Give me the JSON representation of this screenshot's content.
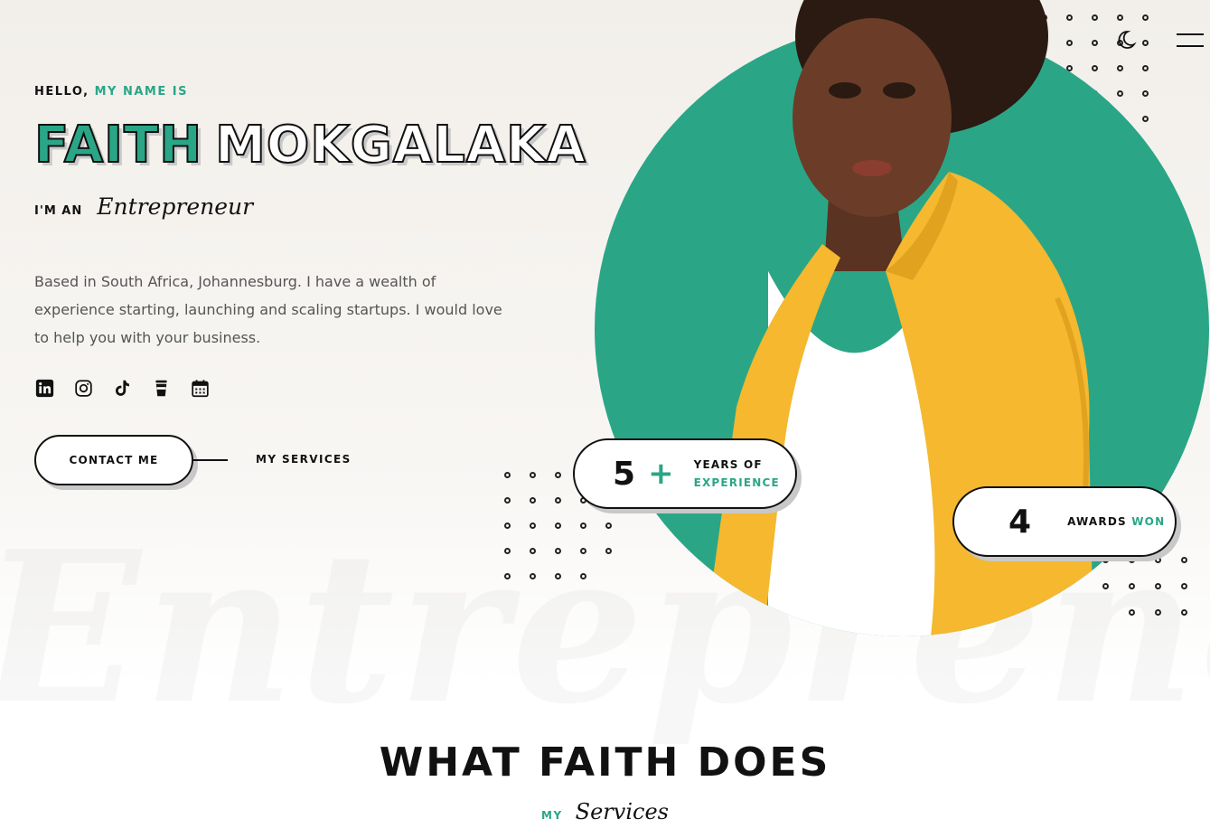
{
  "hero": {
    "greeting_plain": "HELLO,",
    "greeting_accent": "MY NAME IS",
    "first_name": "FAITH",
    "last_name": "MOKGALAKA",
    "role_prefix": "I'M AN",
    "role": "Entrepreneur",
    "background_word": "Entrepreneur",
    "bio": "Based in South Africa, Johannesburg. I have a wealth of experience starting, launching and scaling startups. I would love to help you with your business."
  },
  "socials": [
    {
      "name": "linkedin-icon"
    },
    {
      "name": "instagram-icon"
    },
    {
      "name": "tiktok-icon"
    },
    {
      "name": "coffee-cup-icon"
    },
    {
      "name": "calendar-icon"
    }
  ],
  "actions": {
    "contact_label": "CONTACT ME",
    "services_label": "MY SERVICES"
  },
  "stats": {
    "experience": {
      "number": "5",
      "plus": "+",
      "line1": "YEARS OF",
      "line2": "EXPERIENCE"
    },
    "awards": {
      "number": "4",
      "label_plain": "AWARDS",
      "label_accent": "WON"
    }
  },
  "header_icons": {
    "theme_toggle": "moon-icon",
    "menu": "hamburger-menu-icon"
  },
  "section": {
    "title": "WHAT FAITH DOES",
    "sub_prefix": "MY",
    "sub_word": "Services"
  },
  "colors": {
    "accent": "#2aa687",
    "jacket": "#f5b82e",
    "text": "#111111"
  }
}
